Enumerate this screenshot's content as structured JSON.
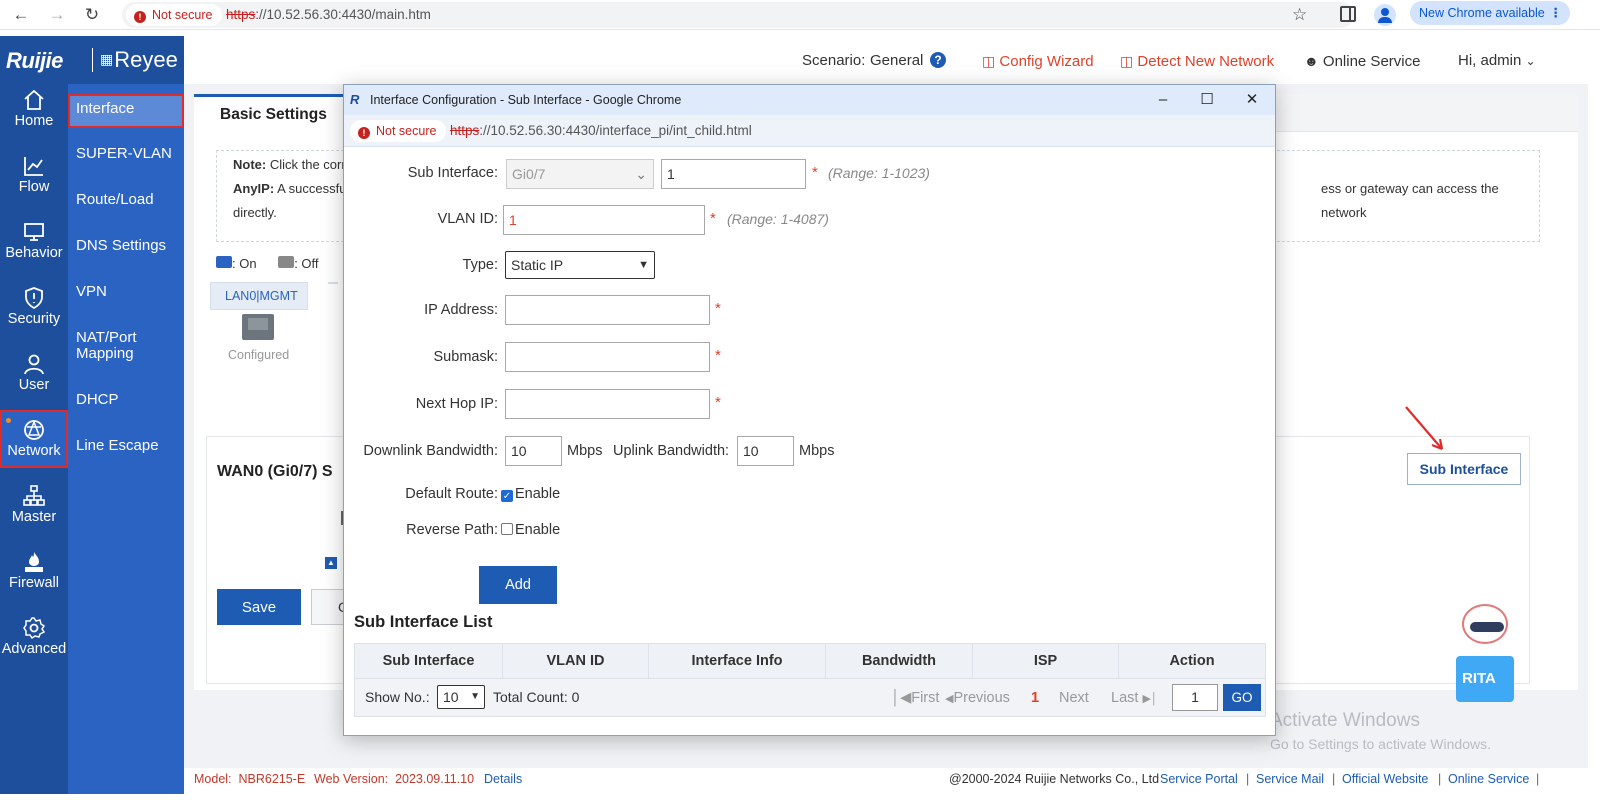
{
  "browser": {
    "not_secure": "Not secure",
    "url_proto": "https",
    "url_rest": "://10.52.56.30:4430/main.htm",
    "update": "New Chrome available"
  },
  "logo": {
    "brand1": "Ruijie",
    "brand2": "Reyee"
  },
  "header": {
    "scenario_label": "Scenario:",
    "scenario_value": "General",
    "config_wizard": "Config Wizard",
    "detect_network": "Detect New Network",
    "online_service": "Online Service",
    "user": "Hi, admin"
  },
  "iconbar": [
    {
      "label": "Home"
    },
    {
      "label": "Flow"
    },
    {
      "label": "Behavior"
    },
    {
      "label": "Security"
    },
    {
      "label": "User"
    },
    {
      "label": "Network"
    },
    {
      "label": "Master"
    },
    {
      "label": "Firewall"
    },
    {
      "label": "Advanced"
    }
  ],
  "submenu": [
    {
      "label": "Interface"
    },
    {
      "label": "SUPER-VLAN"
    },
    {
      "label": "Route/Load"
    },
    {
      "label": "DNS Settings"
    },
    {
      "label": "VPN"
    },
    {
      "label": "NAT/Port Mapping"
    },
    {
      "label": "DHCP"
    },
    {
      "label": "Line Escape"
    }
  ],
  "main": {
    "tab_basic": "Basic Settings",
    "note_label": "Note:",
    "note_text": "Click the corre",
    "anyip_label": "AnyIP:",
    "anyip_text": "A successful",
    "note_right": "ess or gateway can access the network",
    "note_directly": "directly.",
    "legend_on": ": On",
    "legend_off": ": Off",
    "port_tag": "LAN0|MGMT",
    "port_status": "Configured",
    "wan_title": "WAN0 (Gi0/7) S",
    "save": "Save",
    "sub_interface_btn": "Sub Interface",
    "rita": "RITA",
    "activate_title": "Activate Windows",
    "activate_sub": "Go to Settings to activate Windows."
  },
  "footer": {
    "model_label": "Model:",
    "model": "NBR6215-E",
    "web_version_label": "Web Version:",
    "web_version": "2023.09.11.10",
    "details": "Details",
    "copyright": "@2000-2024 Ruijie Networks Co., Ltd",
    "links": [
      "Service Portal",
      "Service Mail",
      "Official Website",
      "Online Service"
    ]
  },
  "popup": {
    "title": "Interface Configuration - Sub Interface - Google Chrome",
    "not_secure": "Not secure",
    "url_proto": "https",
    "url_rest": "://10.52.56.30:4430/interface_pi/int_child.html",
    "form": {
      "sub_interface_label": "Sub Interface:",
      "sub_interface_select": "Gi0/7",
      "sub_interface_num": "1",
      "sub_interface_range": "(Range: 1-1023)",
      "vlan_label": "VLAN ID:",
      "vlan_value": "1",
      "vlan_range": "(Range: 1-4087)",
      "type_label": "Type:",
      "type_value": "Static IP",
      "ip_label": "IP Address:",
      "ip_value": "",
      "mask_label": "Submask:",
      "mask_value": "",
      "hop_label": "Next Hop IP:",
      "hop_value": "",
      "down_label": "Downlink Bandwidth:",
      "down_value": "10",
      "mbps": "Mbps",
      "up_label": "Uplink Bandwidth:",
      "up_value": "10",
      "default_route_label": "Default Route:",
      "reverse_path_label": "Reverse Path:",
      "enable": "Enable",
      "add": "Add"
    },
    "list_title": "Sub Interface List",
    "columns": [
      "Sub Interface",
      "VLAN ID",
      "Interface Info",
      "Bandwidth",
      "ISP",
      "Action"
    ],
    "show_no_label": "Show No.:",
    "show_no_value": "10",
    "total_count": "Total Count: 0",
    "pager": {
      "first": "First",
      "previous": "Previous",
      "current": "1",
      "next": "Next",
      "last": "Last",
      "page_input": "1",
      "go": "GO"
    }
  },
  "colors": {
    "primary": "#1e4f9c",
    "accent_red": "#e0412a",
    "highlight_outline": "#e02b2b"
  }
}
